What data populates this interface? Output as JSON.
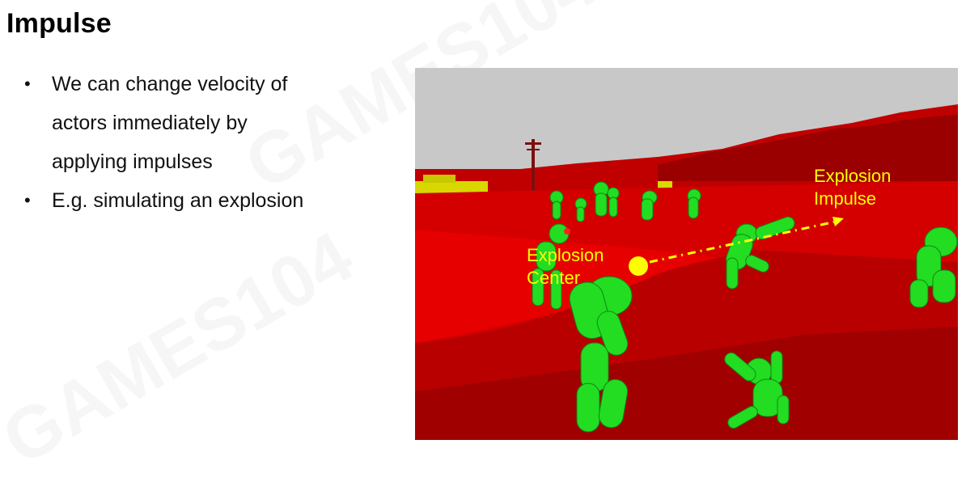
{
  "slide": {
    "title": "Impulse",
    "bullets": [
      {
        "text": "We can change velocity of\nactors immediately by\napplying impulses"
      },
      {
        "text": "E.g. simulating an explosion"
      }
    ],
    "bullet_glyph": "•"
  },
  "figure": {
    "label_center": "Explosion\nCenter",
    "label_impulse": "Explosion\nImpulse",
    "colors": {
      "sky": "#c8c8c8",
      "terrain": "#d40000",
      "terrain_dark": "#a00000",
      "ragdoll": "#22dd22",
      "explosion": "#ffff00"
    }
  },
  "watermark": {
    "text": "GAMES104"
  }
}
